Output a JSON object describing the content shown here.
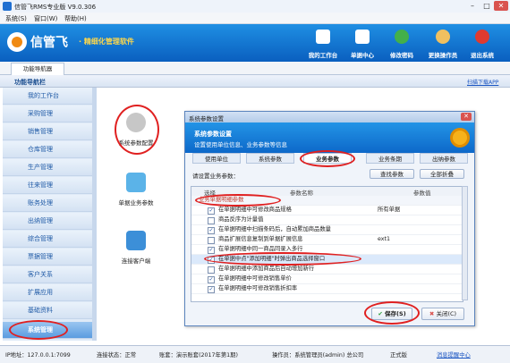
{
  "window": {
    "title": "信管飞RMS专业版 V9.0.306"
  },
  "menu": [
    "系统(S)",
    "窗口(W)",
    "帮助(H)"
  ],
  "header": {
    "brand": "信管飞",
    "slogan": "· 精细化管理软件",
    "buttons": [
      {
        "label": "我的工作台",
        "color": "#2a7fd8"
      },
      {
        "label": "单据中心",
        "color": "#3a8fe0"
      },
      {
        "label": "修改密码",
        "color": "#43b049"
      },
      {
        "label": "更换操作员",
        "color": "#2f7bd0"
      },
      {
        "label": "退出系统",
        "color": "#e03a2f"
      }
    ]
  },
  "tab": {
    "label": "功能导航器"
  },
  "funcbar": {
    "title": "功能导航栏",
    "link": "扫描下载APP"
  },
  "sidebar": {
    "items": [
      "我的工作台",
      "采购管理",
      "销售管理",
      "仓库管理",
      "生产管理",
      "往来管理",
      "账务处理",
      "出纳管理",
      "综合管理",
      "票据管理",
      "客户关系",
      "扩展应用",
      "基础资料",
      "系统管理"
    ],
    "active": "系统管理"
  },
  "features": [
    {
      "label": "系统参数配置",
      "color": "#c7c7c7"
    },
    {
      "label": "单据业务参数",
      "color": "#5bb3e8"
    },
    {
      "label": "连接客户端",
      "color": "#3c8fd8"
    }
  ],
  "dialog": {
    "title": "系统参数设置",
    "banner_title": "系统参数设置",
    "banner_sub": "设置使用单位信息、业务参数等信息",
    "tabs": [
      "使用单位",
      "系统参数",
      "业务参数",
      "业务条期",
      "出纳参数"
    ],
    "active_tab": "业务参数",
    "section_label": "请设置业务参数：",
    "find_button": "查找参数",
    "collapse_button": "全部折叠",
    "grid_headers": [
      "选择",
      "参数名称",
      "参数值"
    ],
    "rows": [
      {
        "group": true,
        "name": "业务单据明细参数",
        "value": ""
      },
      {
        "checked": true,
        "name": "在单据明细中可修改商品规格",
        "value": "所有单据"
      },
      {
        "checked": false,
        "name": "商品反序为计量值",
        "value": ""
      },
      {
        "checked": true,
        "name": "在单据明细中扫描条码后，自动累加商品数量",
        "value": ""
      },
      {
        "checked": false,
        "name": "商品扩展信息复制到单据扩展信息",
        "value": "ext1"
      },
      {
        "checked": true,
        "name": "在单据明细中同一商品同录入多行",
        "value": ""
      },
      {
        "checked": true,
        "name": "在单据中点\"添加明细\"时弹出商品选择窗口",
        "value": "",
        "selected": true
      },
      {
        "checked": false,
        "name": "在单据明细中添加商品后自动增加新行",
        "value": ""
      },
      {
        "checked": true,
        "name": "在单据明细中可修改销售单价",
        "value": ""
      },
      {
        "checked": true,
        "name": "在单据明细中可修改销售折扣率",
        "value": ""
      }
    ],
    "save_button": "保存(S)",
    "close_button": "关闭(C)"
  },
  "status": {
    "ip": "IP地址：127.0.0.1:7099",
    "connection": "连接状态：正常",
    "account": "账套：演示账套(2017年第1期)",
    "operator": "操作员：系统管理员(admin) 总公司",
    "edition": "正式版",
    "messages": "消息提醒中心"
  }
}
